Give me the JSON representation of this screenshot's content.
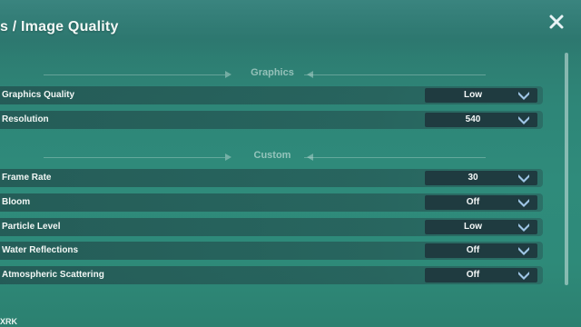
{
  "header": {
    "title": "s / Image Quality"
  },
  "sections": {
    "graphics": "Graphics",
    "custom": "Custom"
  },
  "settings": [
    {
      "label": "Graphics Quality",
      "value": "Low"
    },
    {
      "label": "Resolution",
      "value": "540"
    },
    {
      "label": "Frame Rate",
      "value": "30"
    },
    {
      "label": "Bloom",
      "value": "Off"
    },
    {
      "label": "Particle Level",
      "value": "Low"
    },
    {
      "label": "Water Reflections",
      "value": "Off"
    },
    {
      "label": "Atmospheric Scattering",
      "value": "Off"
    }
  ],
  "footer": {
    "text": "XRK"
  },
  "icons": {
    "close": "close-icon",
    "dropdown": "chevron-down-icon"
  },
  "colors": {
    "background": "#2e8577",
    "row": "#23554f",
    "select": "#1f3b40",
    "chevron": "#9fc6e6"
  }
}
